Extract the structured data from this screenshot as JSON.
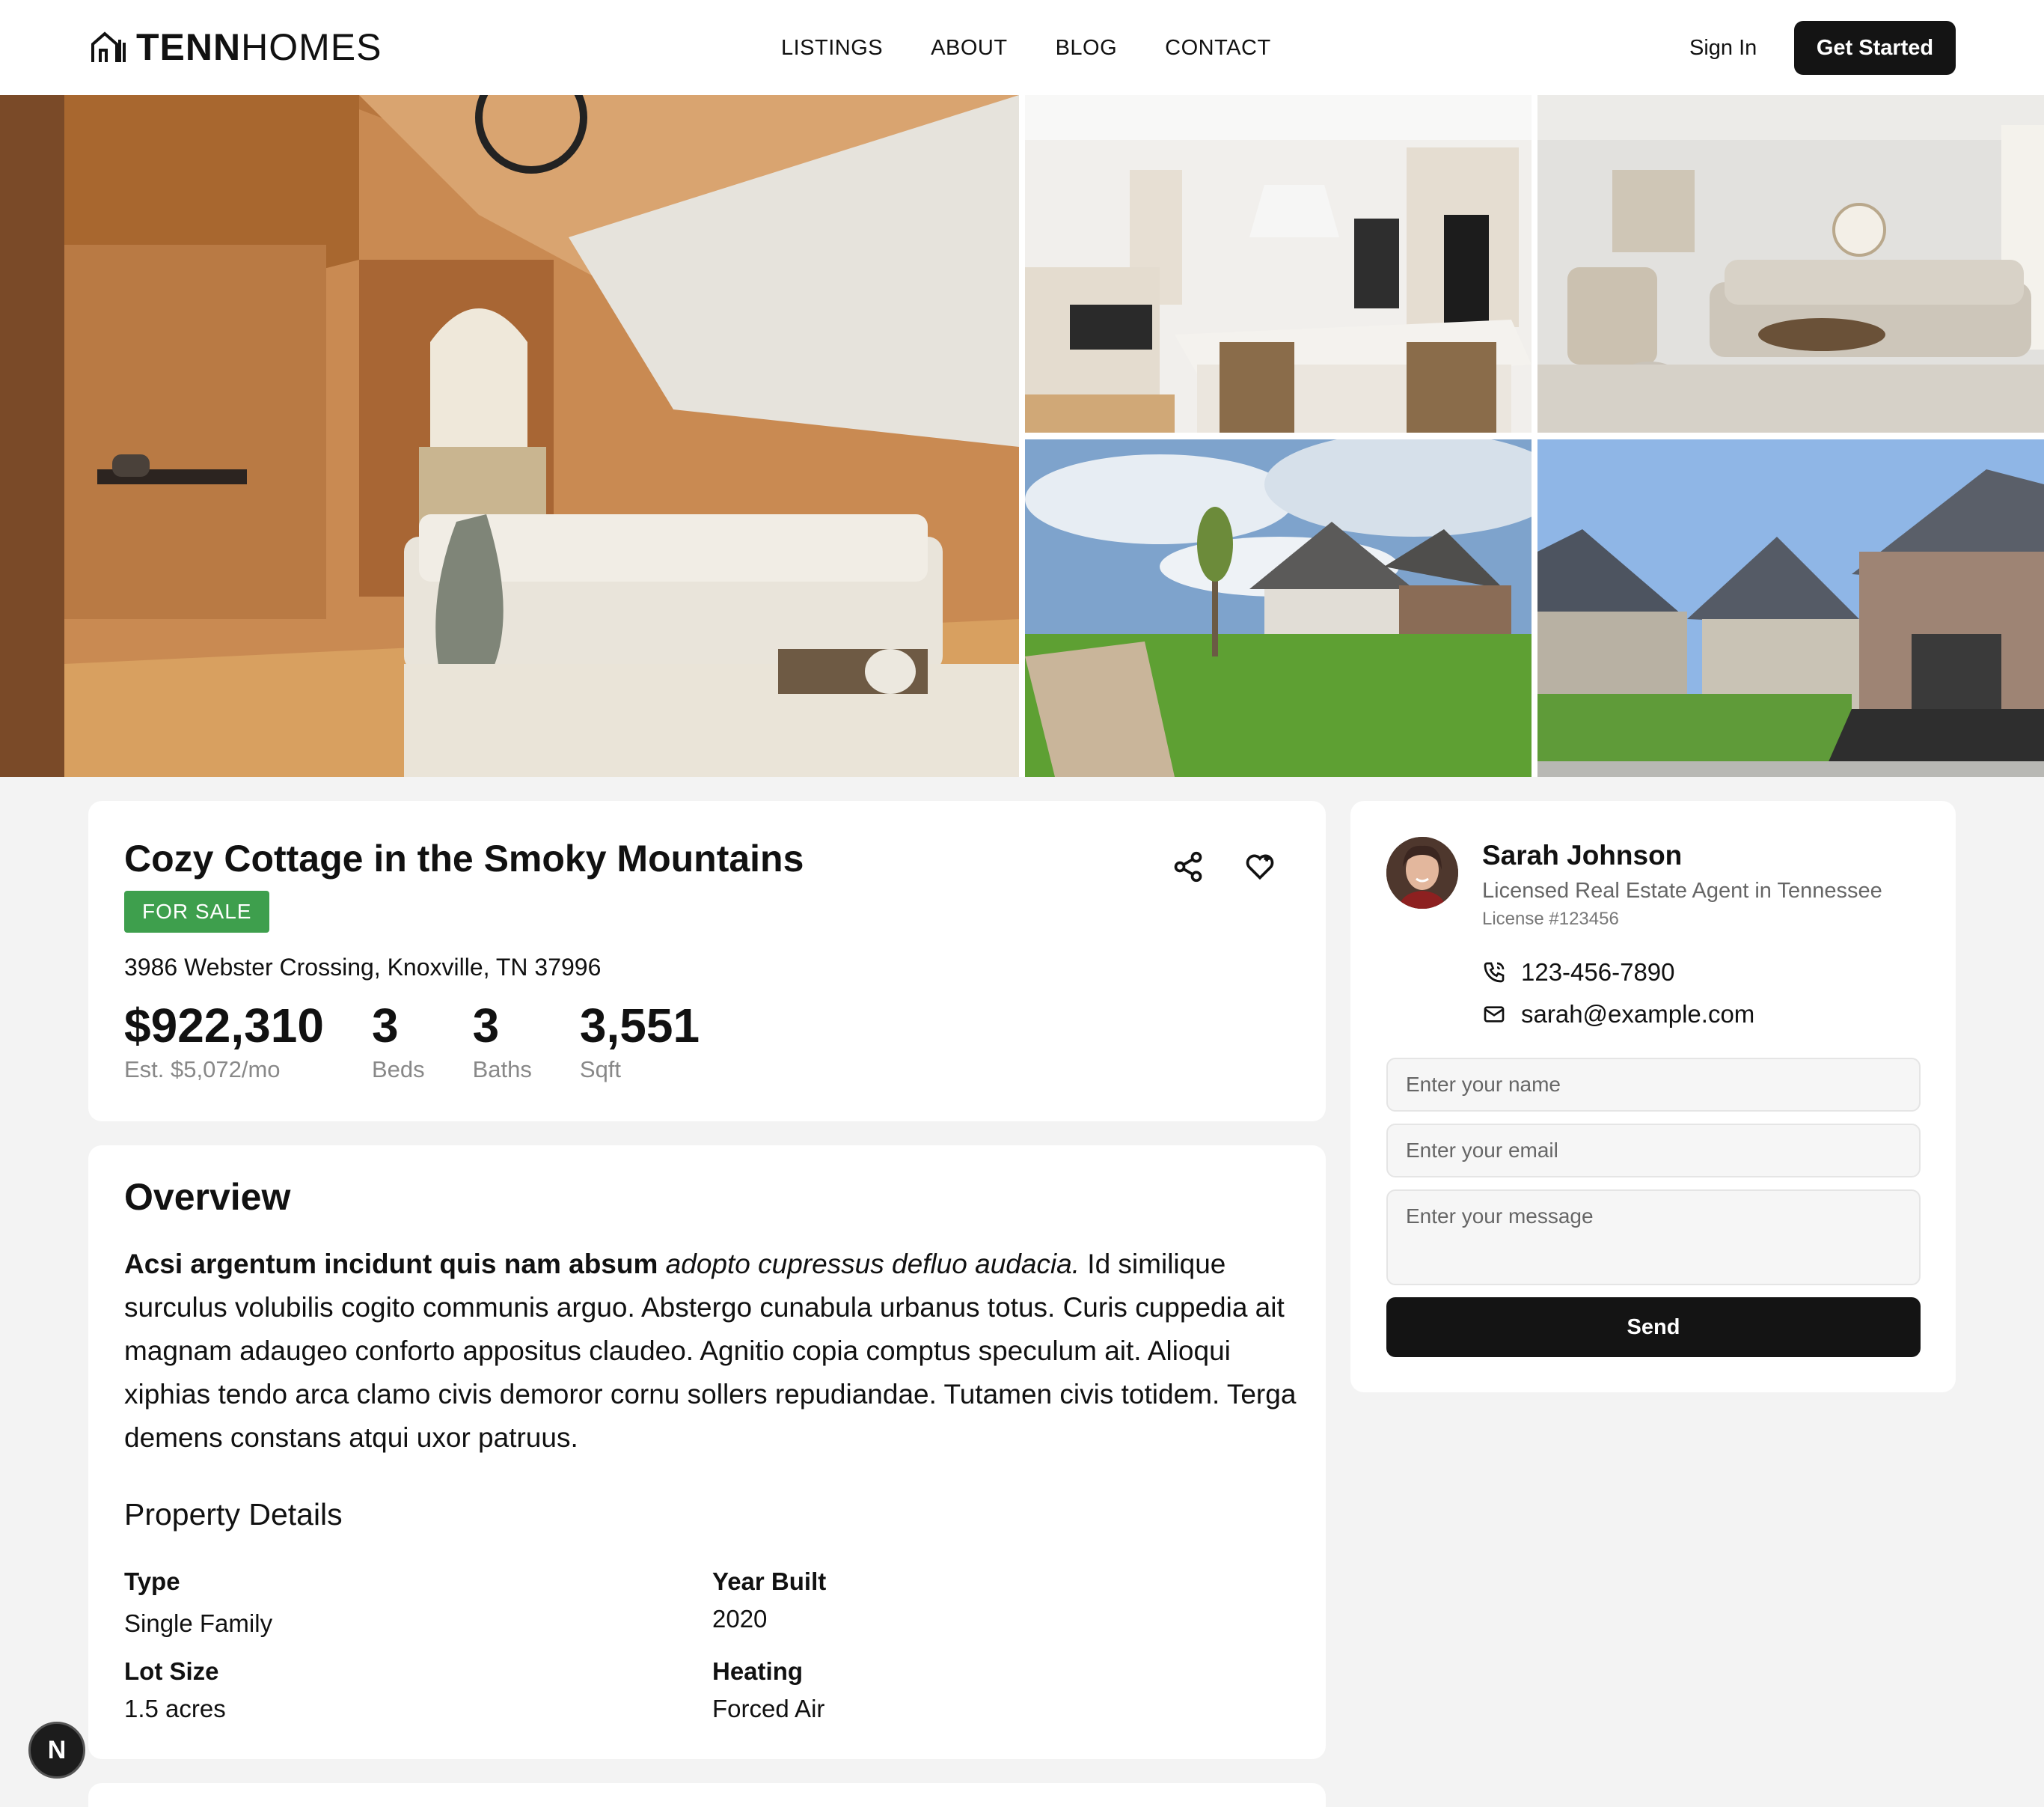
{
  "brand": {
    "bold": "TENN",
    "light": "HOMES"
  },
  "nav": [
    {
      "label": "LISTINGS"
    },
    {
      "label": "ABOUT"
    },
    {
      "label": "BLOG"
    },
    {
      "label": "CONTACT"
    }
  ],
  "header": {
    "signin": "Sign In",
    "cta": "Get Started"
  },
  "gallery": [
    {
      "icon": "bedroom-photo"
    },
    {
      "icon": "kitchen-photo"
    },
    {
      "icon": "living-room-photo"
    },
    {
      "icon": "house-exterior-photo"
    },
    {
      "icon": "street-houses-photo"
    }
  ],
  "listing": {
    "title": "Cozy Cottage in the Smoky Mountains",
    "status": "FOR SALE",
    "address": "3986 Webster Crossing, Knoxville, TN 37996",
    "price": "$922,310",
    "est": "Est. $5,072/mo",
    "beds": "3",
    "beds_label": "Beds",
    "baths": "3",
    "baths_label": "Baths",
    "sqft": "3,551",
    "sqft_label": "Sqft"
  },
  "overview": {
    "heading": "Overview",
    "bold": "Acsi argentum incidunt quis nam absum",
    "italic": "adopto cupressus defluo audacia.",
    "rest": "Id similique surculus volubilis cogito communis arguo. Abstergo cunabula urbanus totus. Curis cuppedia ait magnam adaugeo conforto appositus claudeo. Agnitio copia comptus speculum ait. Alioqui xiphias tendo arca clamo civis demoror cornu sollers repudiandae. Tutamen civis totidem. Terga demens constans atqui uxor patruus."
  },
  "details": {
    "heading": "Property Details",
    "type_label": "Type",
    "type": "Single Family",
    "year_label": "Year Built",
    "year": "2020",
    "lot_label": "Lot Size",
    "lot": "1.5 acres",
    "heating_label": "Heating",
    "heating": "Forced Air"
  },
  "agent": {
    "name": "Sarah Johnson",
    "role": "Licensed Real Estate Agent in Tennessee",
    "license": "License #123456",
    "phone": "123-456-7890",
    "email": "sarah@example.com"
  },
  "form": {
    "name_placeholder": "Enter your name",
    "email_placeholder": "Enter your email",
    "message_placeholder": "Enter your message",
    "send": "Send"
  },
  "fab": {
    "label": "N"
  },
  "colors": {
    "badge": "#3e9f4d",
    "button": "#141414",
    "background": "#f3f3f3"
  }
}
